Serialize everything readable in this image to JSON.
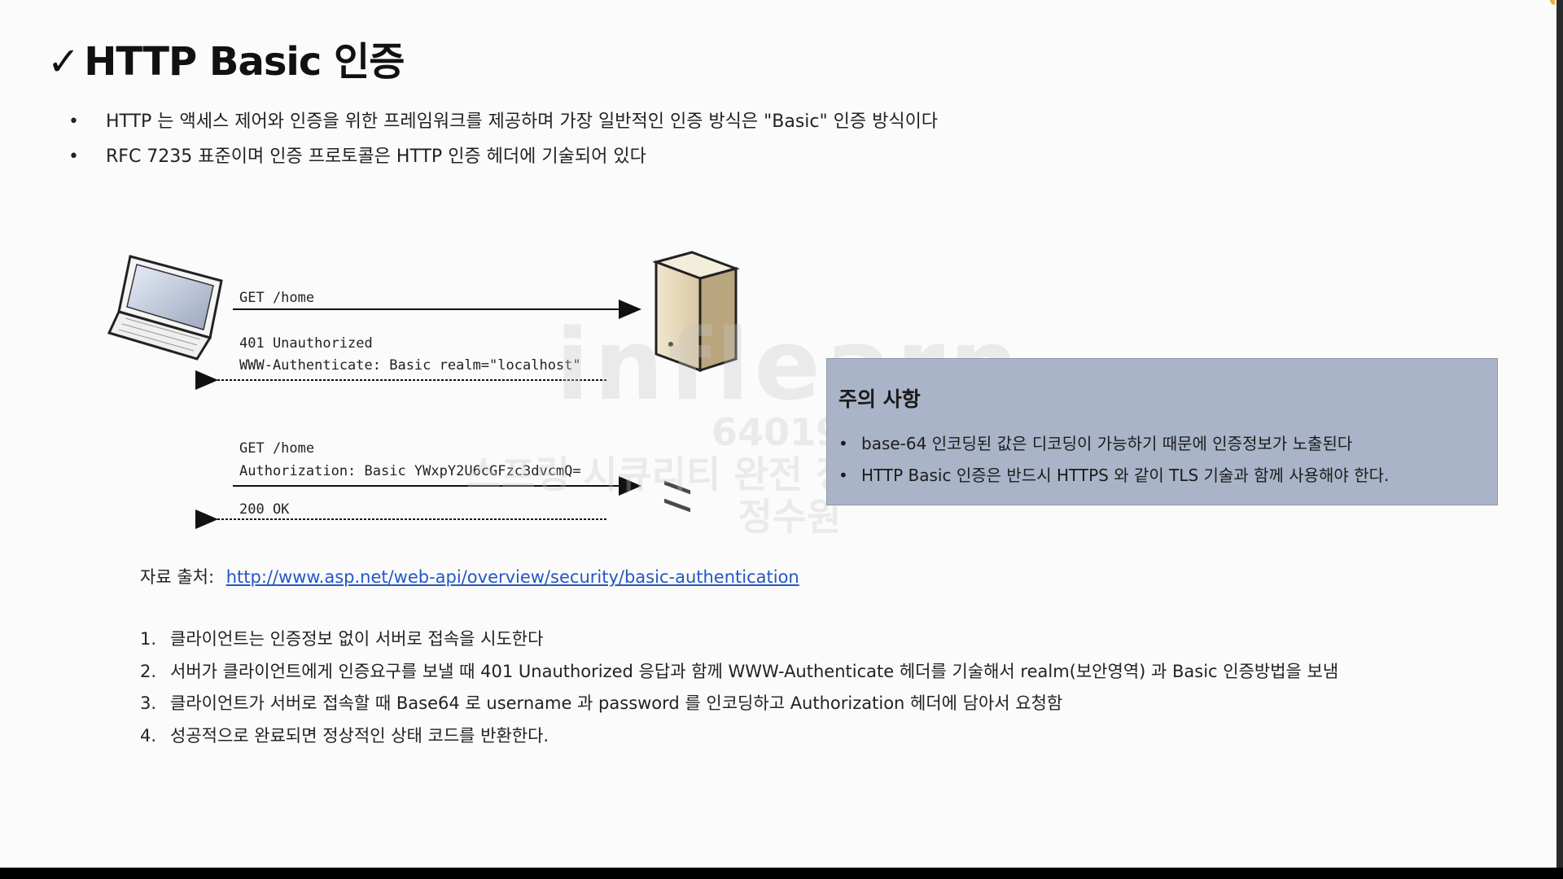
{
  "title": {
    "check": "✓",
    "text": "HTTP Basic 인증"
  },
  "intro_bullets": [
    "HTTP 는 액세스 제어와 인증을 위한 프레임워크를 제공하며 가장 일반적인 인증 방식은 \"Basic\" 인증 방식이다",
    "RFC 7235 표준이며 인증 프로토콜은 HTTP 인증 헤더에 기술되어 있다"
  ],
  "diagram": {
    "request1": "GET /home",
    "response1_line1": "401 Unauthorized",
    "response1_line2": "WWW-Authenticate: Basic realm=\"localhost\"",
    "request2_line1": "GET /home",
    "request2_line2": "Authorization: Basic YWxpY2U6cGFzc3dvcmQ=",
    "response2": "200 OK",
    "client_icon": "laptop-icon",
    "server_icon": "server-icon"
  },
  "callout": {
    "title": "주의 사항",
    "items": [
      "base-64 인코딩된 값은 디코딩이 가능하기 때문에 인증정보가 노출된다",
      "HTTP Basic 인증은 반드시 HTTPS 와 같이 TLS 기술과 함께 사용해야 한다."
    ]
  },
  "source": {
    "label": "자료 출처:",
    "link": "http://www.asp.net/web-api/overview/security/basic-authentication"
  },
  "steps": [
    {
      "num": "1.",
      "text": "클라이언트는 인증정보 없이 서버로 접속을 시도한다"
    },
    {
      "num": "2.",
      "text": "서버가 클라이언트에게 인증요구를 보낼 때 401 Unauthorized 응답과 함께 WWW-Authenticate 헤더를 기술해서 realm(보안영역) 과 Basic 인증방법을 보냄"
    },
    {
      "num": "3.",
      "text": "클라이언트가 서버로 접속할 때 Base64 로 username 과 password 를 인코딩하고 Authorization 헤더에 담아서 요청함"
    },
    {
      "num": "4.",
      "text": "성공적으로 완료되면 정상적인 상태 코드를 반환한다."
    }
  ],
  "watermark": {
    "logo": "inflearn",
    "id": "640199",
    "course": "스프링 시큐리티 완전 정복 [6.x 개정판]",
    "author": "정수원"
  },
  "colors": {
    "callout_bg": "#aab4c8",
    "link": "#2456c4"
  }
}
